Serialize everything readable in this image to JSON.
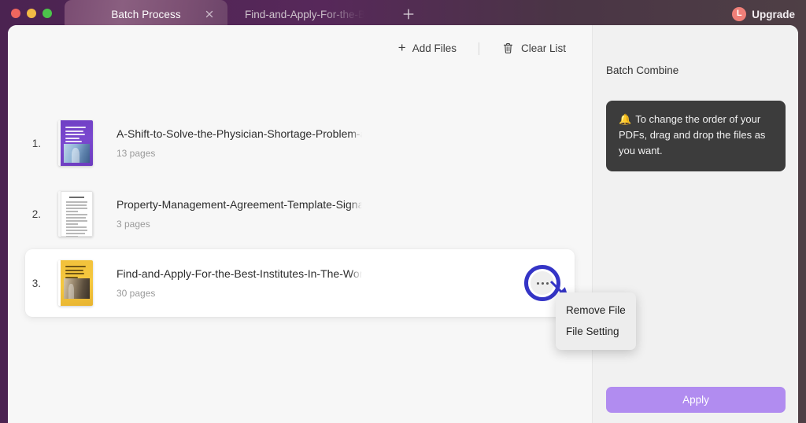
{
  "window": {
    "traffic_lights": [
      "close",
      "minimize",
      "maximize"
    ],
    "colors": {
      "titlebar": "#4b2351",
      "active_tab": "#8a5f80",
      "accent_ring": "#3434c6",
      "apply_button": "#b18cf0",
      "upgrade_badge": "#ef7f78"
    }
  },
  "tabs": [
    {
      "label": "Batch Process",
      "active": true,
      "close_icon": "close-icon"
    },
    {
      "label": "Find-and-Apply-For-the-B",
      "active": false
    }
  ],
  "new_tab": {
    "icon": "plus-icon"
  },
  "upgrade": {
    "label": "Upgrade",
    "badge": "L",
    "icon": "crown-icon"
  },
  "toolbar": {
    "add_files_label": "Add Files",
    "add_files_icon": "plus-icon",
    "clear_list_label": "Clear List",
    "clear_list_icon": "trash-icon"
  },
  "files": [
    {
      "index": "1.",
      "name": "A-Shift-to-Solve-the-Physician-Shortage-Problem-ar",
      "pages": "13 pages",
      "thumb": "purple-report-cover"
    },
    {
      "index": "2.",
      "name": "Property-Management-Agreement-Template-Signatur",
      "pages": "3 pages",
      "thumb": "white-document-cover"
    },
    {
      "index": "3.",
      "name": "Find-and-Apply-For-the-Best-Institutes-In-The-World",
      "pages": "30 pages",
      "thumb": "yellow-report-cover"
    }
  ],
  "more_button": {
    "icon": "ellipsis-icon"
  },
  "context_menu": {
    "items": [
      {
        "label": "Remove File"
      },
      {
        "label": "File Setting"
      }
    ]
  },
  "sidebar": {
    "title": "Batch Combine",
    "tip": {
      "icon": "bell-icon",
      "emoji": "🔔",
      "text": "To change the order of your PDFs, drag and drop the files as you want."
    },
    "apply_label": "Apply"
  }
}
